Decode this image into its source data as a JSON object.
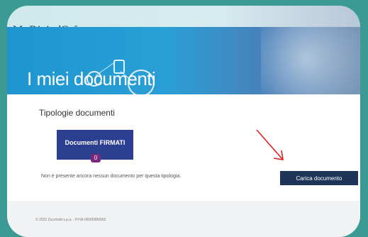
{
  "brand": {
    "prefix": "My",
    "italic": "Digital",
    "suffix": "Caf"
  },
  "hero": {
    "title": "I miei documenti"
  },
  "main": {
    "section_title": "Tipologie documenti",
    "doc_card": {
      "label": "Documenti FIRMATI",
      "count": "0"
    },
    "empty_message": "Non è presente ancora nessun documento per questa tipologia.",
    "upload_button": "Carica documento"
  },
  "footer": {
    "copyright": "© 2022 Zucchetti s.p.a. - P.IVA 05006900962"
  },
  "colors": {
    "frame": "#3c9a94",
    "hero": "#2a9fd6",
    "card": "#2b3e8f",
    "badge": "#7a2a7c",
    "button": "#1f3557",
    "annotation_arrow": "#e02020"
  },
  "icons": [
    "clock-icon",
    "phone-icon",
    "circle-icon"
  ]
}
